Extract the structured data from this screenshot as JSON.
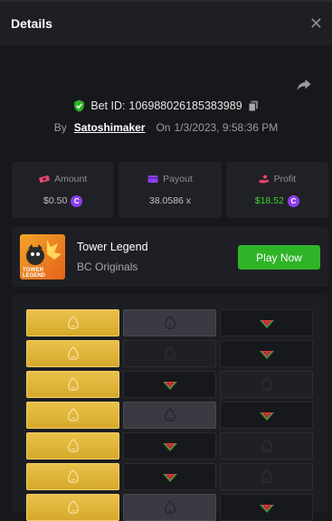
{
  "header": {
    "title": "Details",
    "close_icon": "close-icon"
  },
  "share_icon": "share-icon",
  "bet": {
    "label": "Bet ID:",
    "id": "106988026185383989",
    "copy_icon": "copy-icon",
    "verified_icon": "shield-check-icon"
  },
  "byline": {
    "by": "By",
    "user": "Satoshimaker",
    "on": "On",
    "datetime": "1/3/2023, 9:58:36 PM"
  },
  "stats": {
    "amount": {
      "label": "Amount",
      "value": "$0.50",
      "icon": "money-icon"
    },
    "payout": {
      "label": "Payout",
      "value": "38.0586 x",
      "icon": "wallet-icon"
    },
    "profit": {
      "label": "Profit",
      "value": "$18.52",
      "icon": "profit-icon"
    },
    "coin_symbol": "C",
    "colors": {
      "profit": "#3ed32c",
      "coin": "#8d3ef0",
      "accent_green": "#2fb428"
    }
  },
  "game": {
    "name": "Tower Legend",
    "provider": "BC Originals",
    "thumb_line1": "TOWER",
    "thumb_line2": "LEGEND",
    "play_label": "Play Now"
  },
  "board": {
    "rows": [
      [
        "gold",
        "gray",
        "melon"
      ],
      [
        "gold",
        "dark",
        "melon"
      ],
      [
        "gold",
        "melon",
        "dark"
      ],
      [
        "gold",
        "gray",
        "melon"
      ],
      [
        "gold",
        "melon",
        "dark"
      ],
      [
        "gold",
        "melon",
        "dark"
      ],
      [
        "gold",
        "gray",
        "melon"
      ]
    ]
  }
}
